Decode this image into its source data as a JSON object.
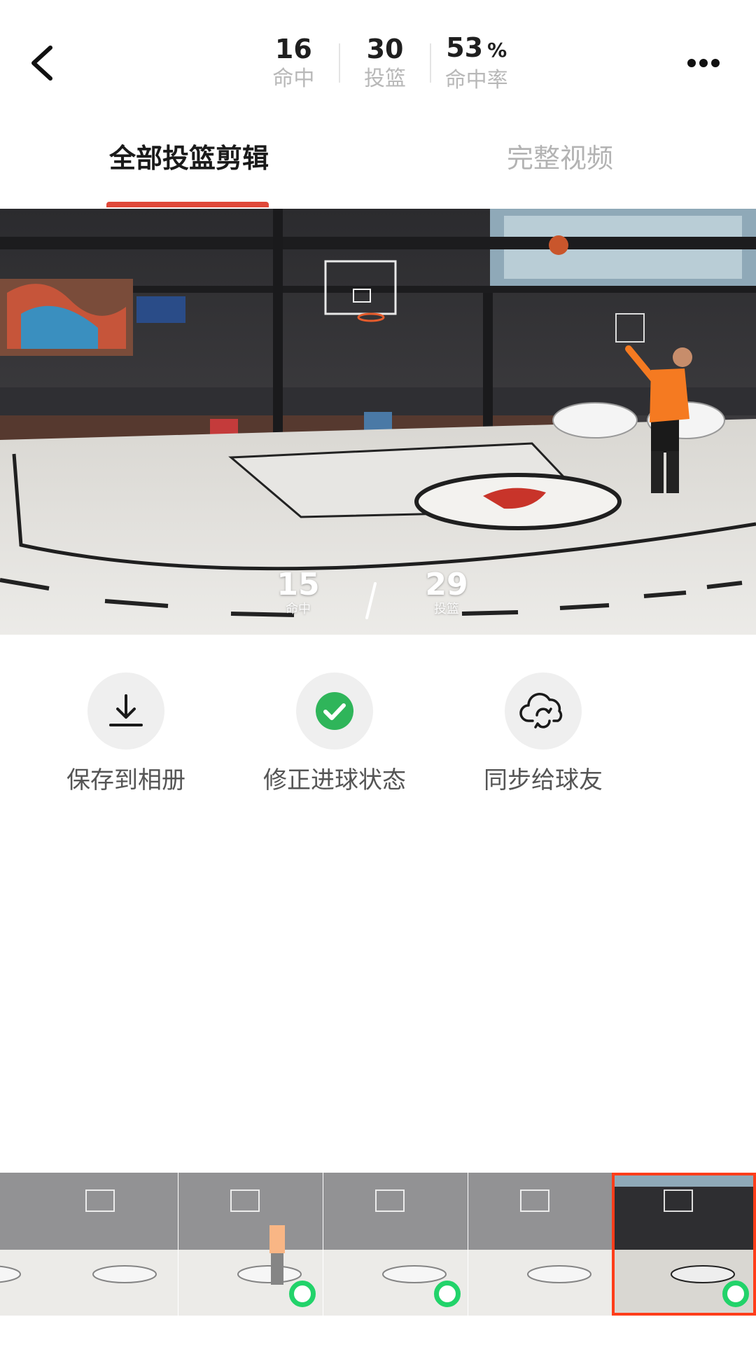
{
  "header": {
    "back_icon": "chevron-left-icon",
    "more_icon": "more-horizontal-icon",
    "stats": [
      {
        "value": "16",
        "unit": "",
        "label": "命中"
      },
      {
        "value": "30",
        "unit": "",
        "label": "投篮"
      },
      {
        "value": "53",
        "unit": "%",
        "label": "命中率"
      }
    ]
  },
  "tabs": [
    {
      "label": "全部投篮剪辑",
      "active": true
    },
    {
      "label": "完整视频",
      "active": false
    }
  ],
  "video": {
    "made": "15",
    "made_label": "命中",
    "attempts": "29",
    "attempts_label": "投篮"
  },
  "actions": [
    {
      "label": "保存到相册",
      "icon": "download-icon"
    },
    {
      "label": "修正进球状态",
      "icon": "check-circle-icon"
    },
    {
      "label": "同步给球友",
      "icon": "cloud-sync-icon"
    }
  ],
  "colors": {
    "accent": "#e0493a",
    "selected_border": "#ff3d1a",
    "made_ring": "#22d36a",
    "check_green": "#2fb55a"
  }
}
